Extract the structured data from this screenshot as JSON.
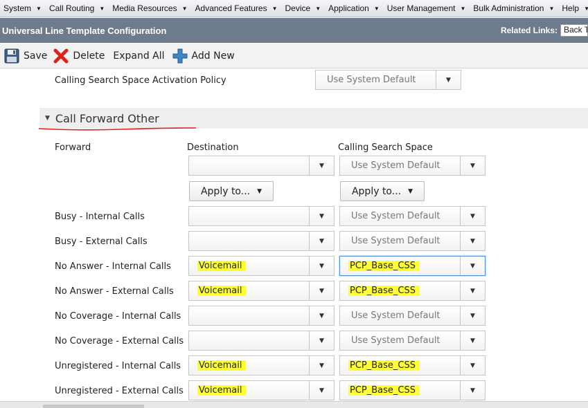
{
  "menu": [
    "System",
    "Call Routing",
    "Media Resources",
    "Advanced Features",
    "Device",
    "Application",
    "User Management",
    "Bulk Administration",
    "Help"
  ],
  "header": {
    "title": "Universal Line Template Configuration",
    "related_links_label": "Related Links:",
    "related_links_value": "Back To Find/List"
  },
  "toolbar": {
    "save": "Save",
    "delete": "Delete",
    "expand_all": "Expand All",
    "add_new": "Add New"
  },
  "css_activation": {
    "label": "Calling Search Space Activation Policy",
    "value": "Use System Default"
  },
  "section": {
    "title": "Call Forward Other"
  },
  "columns": {
    "forward": "Forward",
    "destination": "Destination",
    "css": "Calling Search Space"
  },
  "apply_to": "Apply to...",
  "top_row": {
    "destination": "",
    "css": "Use System Default"
  },
  "rows": [
    {
      "label": "Busy - Internal Calls",
      "destination": "",
      "css": "Use System Default"
    },
    {
      "label": "Busy - External Calls",
      "destination": "",
      "css": "Use System Default"
    },
    {
      "label": "No Answer - Internal Calls",
      "destination": "Voicemail",
      "css": "PCP_Base_CSS"
    },
    {
      "label": "No Answer - External Calls",
      "destination": "Voicemail",
      "css": "PCP_Base_CSS"
    },
    {
      "label": "No Coverage - Internal Calls",
      "destination": "",
      "css": "Use System Default"
    },
    {
      "label": "No Coverage - External Calls",
      "destination": "",
      "css": "Use System Default"
    },
    {
      "label": "Unregistered - Internal Calls",
      "destination": "Voicemail",
      "css": "PCP_Base_CSS"
    },
    {
      "label": "Unregistered - External Calls",
      "destination": "Voicemail",
      "css": "PCP_Base_CSS"
    }
  ],
  "colors": {
    "title_bar": "#6d7b8d",
    "highlight": "#ffff33",
    "annotation_underline": "#e0201a",
    "delete_icon": "#d9261c",
    "add_icon": "#3f86c9"
  }
}
